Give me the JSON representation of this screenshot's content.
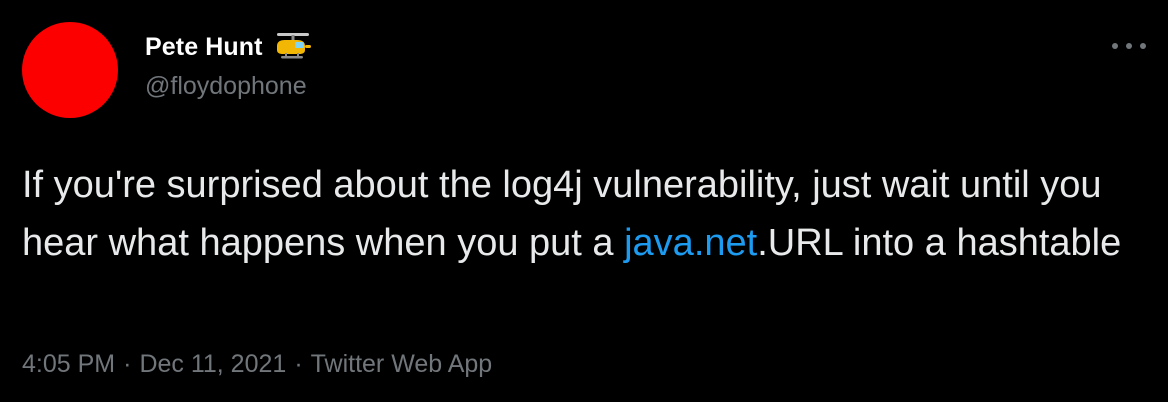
{
  "author": {
    "display_name": "Pete Hunt",
    "name_emoji": "helicopter-icon",
    "handle": "@floydophone",
    "avatar_color": "#fc0000"
  },
  "tweet": {
    "text_before_link": "If you're surprised about the log4j vulnerability, just wait until you hear what happens when you put a ",
    "link_text": "java.net",
    "text_after_link": ".URL into a hashtable"
  },
  "meta": {
    "time": "4:05 PM",
    "separator": "·",
    "date": "Dec 11, 2021",
    "source": "Twitter Web App"
  },
  "colors": {
    "background": "#000000",
    "text": "#e7e9ea",
    "secondary": "#71767b",
    "link": "#1d9bf0"
  }
}
